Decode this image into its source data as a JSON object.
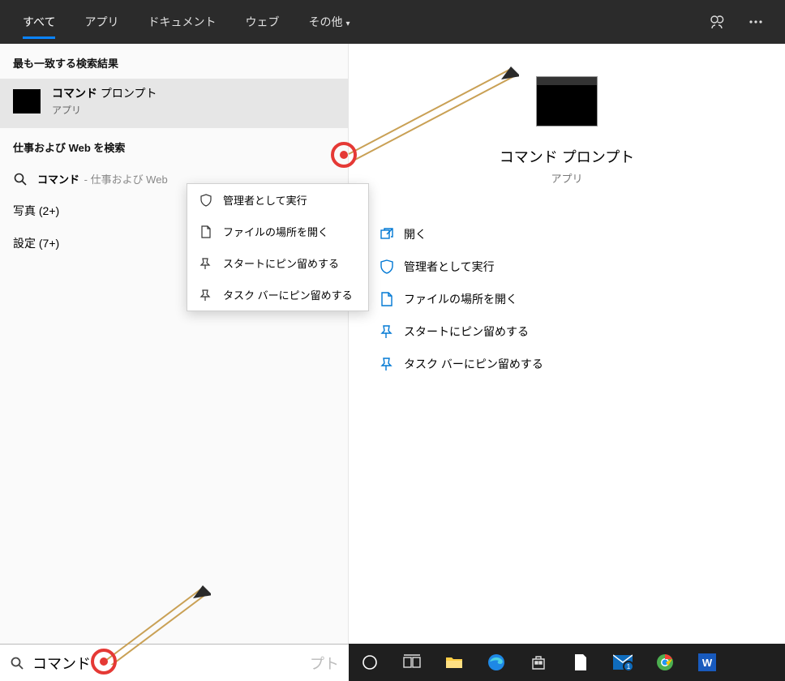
{
  "header": {
    "tabs": {
      "all": "すべて",
      "apps": "アプリ",
      "docs": "ドキュメント",
      "web": "ウェブ",
      "more": "その他"
    }
  },
  "left": {
    "best_match_header": "最も一致する検索結果",
    "best_match": {
      "title_bold": "コマンド",
      "title_rest": " プロンプト",
      "subtitle": "アプリ"
    },
    "web_header": "仕事および Web を検索",
    "web_query_bold": "コマンド",
    "web_query_hint": " - 仕事および Web",
    "photos": "写真 (2+)",
    "settings": "設定 (7+)"
  },
  "context_menu": {
    "run_admin": "管理者として実行",
    "open_location": "ファイルの場所を開く",
    "pin_start": "スタートにピン留めする",
    "pin_taskbar": "タスク バーにピン留めする"
  },
  "preview": {
    "title": "コマンド プロンプト",
    "subtitle": "アプリ"
  },
  "actions": {
    "open": "開く",
    "run_admin": "管理者として実行",
    "open_location": "ファイルの場所を開く",
    "pin_start": "スタートにピン留めする",
    "pin_taskbar": "タスク バーにピン留めする"
  },
  "search": {
    "value": "コマンド",
    "placeholder_suffix": "プト"
  },
  "colors": {
    "blue": "#0078d4",
    "red": "#e53935"
  }
}
